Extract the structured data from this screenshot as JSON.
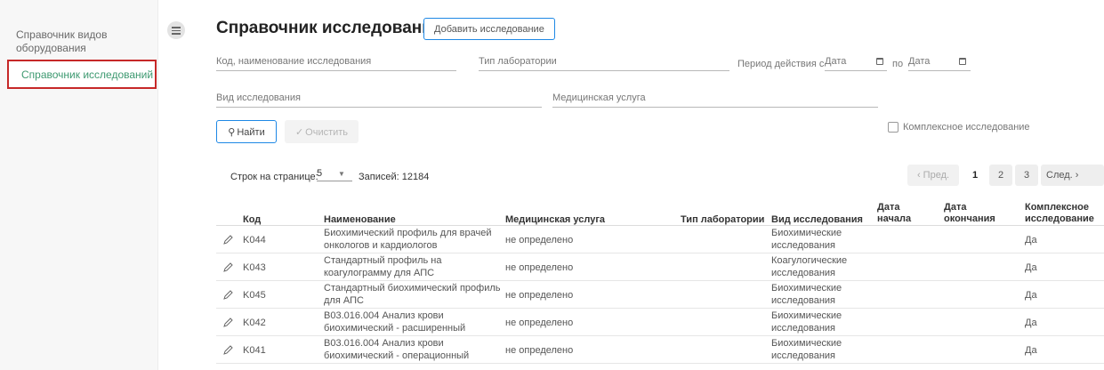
{
  "sidebar": {
    "items": [
      {
        "label": "Справочник видов оборудования"
      },
      {
        "label": "Справочник исследований"
      }
    ]
  },
  "header": {
    "title": "Справочник исследований",
    "add_button": "Добавить исследование"
  },
  "filters": {
    "code_name_placeholder": "Код, наименование исследования",
    "lab_type_placeholder": "Тип лаборатории",
    "period_from_label": "Период действия с",
    "date_from_placeholder": "Дата",
    "period_to_label": "по",
    "date_to_placeholder": "Дата",
    "research_type_placeholder": "Вид исследования",
    "med_service_placeholder": "Медицинская услуга",
    "complex_label": "Комплексное исследование",
    "complex_checked": false,
    "find_button": "Найти",
    "clear_button": "Очистить"
  },
  "pagination": {
    "rows_per_page_label": "Строк на странице:",
    "rows_per_page": "5",
    "records_label": "Записей:",
    "records_count": "12184",
    "prev": "Пред.",
    "pages": [
      "1",
      "2",
      "3"
    ],
    "current_page": "1",
    "next": "След."
  },
  "table": {
    "columns": {
      "code": "Код",
      "name": "Наименование",
      "med_service": "Медицинская услуга",
      "lab_type": "Тип лаборатории",
      "research_type": "Вид исследования",
      "start_date_1": "Дата",
      "start_date_2": "начала",
      "end_date_1": "Дата",
      "end_date_2": "окончания",
      "complex_1": "Комплексное",
      "complex_2": "исследование"
    },
    "rows": [
      {
        "code": "K044",
        "name_1": "Биохимический профиль для врачей",
        "name_2": "онкологов и кардиологов",
        "med_service": "не определено",
        "lab_type": "",
        "type_1": "Биохимические",
        "type_2": "исследования",
        "start": "",
        "end": "",
        "complex": "Да"
      },
      {
        "code": "K043",
        "name_1": "Стандартный профиль на",
        "name_2": "коагулограмму для АПС",
        "med_service": "не определено",
        "lab_type": "",
        "type_1": "Коагулогические",
        "type_2": "исследования",
        "start": "",
        "end": "",
        "complex": "Да"
      },
      {
        "code": "K045",
        "name_1": "Стандартный биохимический профиль",
        "name_2": "для АПС",
        "med_service": "не определено",
        "lab_type": "",
        "type_1": "Биохимические",
        "type_2": "исследования",
        "start": "",
        "end": "",
        "complex": "Да"
      },
      {
        "code": "K042",
        "name_1": "B03.016.004 Анализ крови",
        "name_2": "биохимический - расширенный",
        "med_service": "не определено",
        "lab_type": "",
        "type_1": "Биохимические",
        "type_2": "исследования",
        "start": "",
        "end": "",
        "complex": "Да"
      },
      {
        "code": "K041",
        "name_1": "B03.016.004 Анализ крови",
        "name_2": "биохимический - операционный",
        "med_service": "не определено",
        "lab_type": "",
        "type_1": "Биохимические",
        "type_2": "исследования",
        "start": "",
        "end": "",
        "complex": "Да"
      }
    ]
  },
  "colors": {
    "accent": "#1e88e5",
    "active_text": "#3d9970",
    "active_border": "#c62828"
  },
  "icons": [
    "menu-icon",
    "calendar-icon",
    "search-icon",
    "eraser-icon",
    "chevron-down-icon",
    "pencil-icon"
  ]
}
